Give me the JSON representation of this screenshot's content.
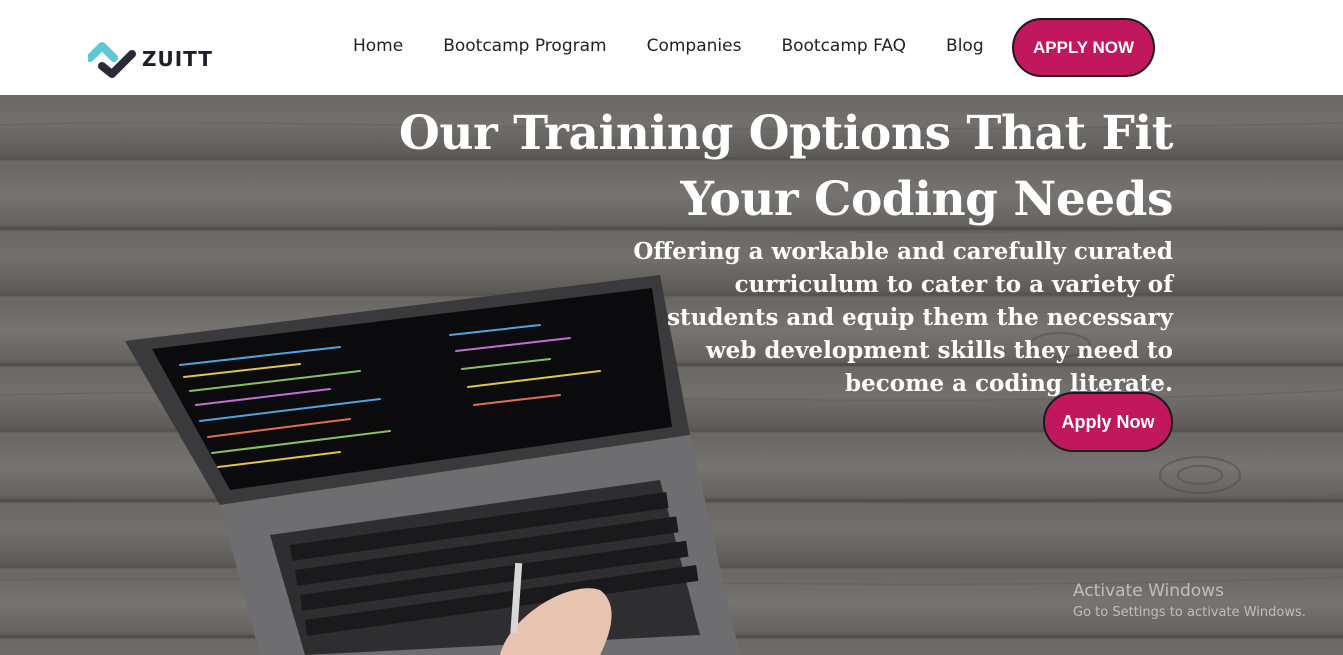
{
  "brand": {
    "name": "ZUITT",
    "icon": "zuitt-logo-icon",
    "colors": {
      "teal": "#5cc8d3",
      "dark": "#2b2b38"
    }
  },
  "nav": {
    "links": [
      {
        "label": "Home"
      },
      {
        "label": "Bootcamp Program"
      },
      {
        "label": "Companies"
      },
      {
        "label": "Bootcamp FAQ"
      },
      {
        "label": "Blog"
      }
    ],
    "cta_label": "APPLY NOW"
  },
  "hero": {
    "title": "Our Training Options That Fit Your Coding Needs",
    "subtitle": "Offering a workable and carefully curated curriculum to cater to a variety of students and equip them the necessary web development skills they need to become a coding literate.",
    "cta_label": "Apply Now",
    "background": "laptop-on-wooden-desk-photo"
  },
  "os_watermark": {
    "title": "Activate Windows",
    "subtitle": "Go to Settings to activate Windows."
  },
  "colors": {
    "accent": "#c0175d",
    "nav_bg": "#ffffff",
    "hero_text": "#ffffff"
  }
}
